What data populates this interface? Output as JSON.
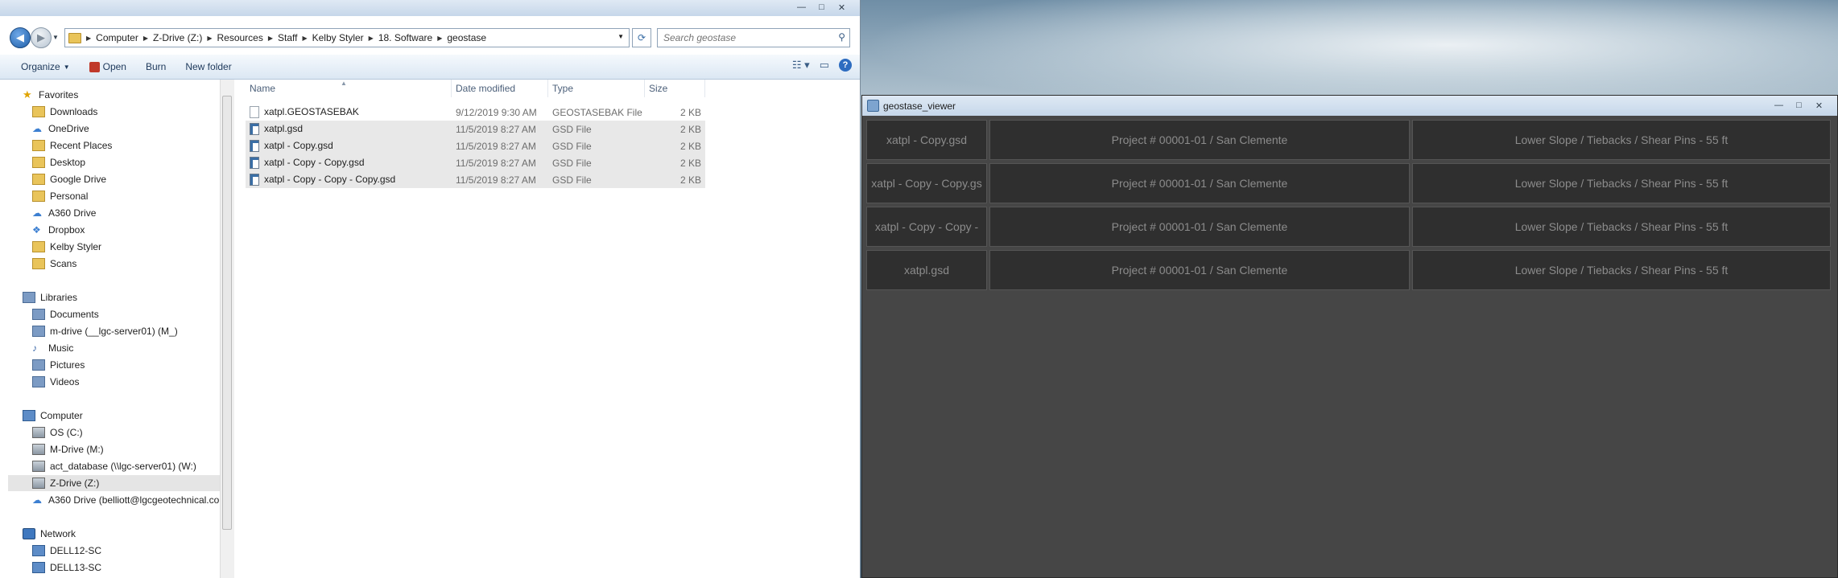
{
  "explorer": {
    "window_buttons": [
      "—",
      "□",
      "✕"
    ],
    "breadcrumbs": [
      "Computer",
      "Z-Drive (Z:)",
      "Resources",
      "Staff",
      "Kelby Styler",
      "18. Software",
      "geostase"
    ],
    "search_placeholder": "Search geostase",
    "toolbar": {
      "organize": "Organize",
      "open": "Open",
      "burn": "Burn",
      "new_folder": "New folder"
    },
    "nav": {
      "favorites_header": "Favorites",
      "favorites": [
        "Downloads",
        "OneDrive",
        "Recent Places",
        "Desktop",
        "Google Drive",
        "Personal",
        "A360 Drive",
        "Dropbox",
        "Kelby Styler",
        "Scans"
      ],
      "libraries_header": "Libraries",
      "libraries": [
        "Documents",
        "m-drive (__lgc-server01) (M_)",
        "Music",
        "Pictures",
        "Videos"
      ],
      "computer_header": "Computer",
      "computer": [
        "OS (C:)",
        "M-Drive (M:)",
        "act_database (\\\\lgc-server01) (W:)",
        "Z-Drive (Z:)",
        "A360 Drive (belliott@lgcgeotechnical.co"
      ],
      "network_header": "Network",
      "network": [
        "DELL12-SC",
        "DELL13-SC"
      ]
    },
    "columns": [
      "Name",
      "Date modified",
      "Type",
      "Size"
    ],
    "files": [
      {
        "name": "xatpl.GEOSTASEBAK",
        "date": "9/12/2019 9:30 AM",
        "type": "GEOSTASEBAK File",
        "size": "2 KB"
      },
      {
        "name": "xatpl.gsd",
        "date": "11/5/2019 8:27 AM",
        "type": "GSD File",
        "size": "2 KB"
      },
      {
        "name": "xatpl - Copy.gsd",
        "date": "11/5/2019 8:27 AM",
        "type": "GSD File",
        "size": "2 KB"
      },
      {
        "name": "xatpl - Copy - Copy.gsd",
        "date": "11/5/2019 8:27 AM",
        "type": "GSD File",
        "size": "2 KB"
      },
      {
        "name": "xatpl - Copy - Copy - Copy.gsd",
        "date": "11/5/2019 8:27 AM",
        "type": "GSD File",
        "size": "2 KB"
      }
    ]
  },
  "viewer": {
    "title": "geostase_viewer",
    "window_buttons": [
      "—",
      "□",
      "✕"
    ],
    "rows": [
      {
        "file": "xatpl - Copy.gsd",
        "project": "Project # 00001-01 / San Clemente",
        "description": "Lower Slope / Tiebacks / Shear Pins - 55 ft"
      },
      {
        "file": "xatpl - Copy - Copy.gs",
        "project": "Project # 00001-01 / San Clemente",
        "description": "Lower Slope / Tiebacks / Shear Pins - 55 ft"
      },
      {
        "file": "xatpl - Copy - Copy -",
        "project": "Project # 00001-01 / San Clemente",
        "description": "Lower Slope / Tiebacks / Shear Pins - 55 ft"
      },
      {
        "file": "xatpl.gsd",
        "project": "Project # 00001-01 / San Clemente",
        "description": "Lower Slope / Tiebacks / Shear Pins - 55 ft"
      }
    ]
  }
}
